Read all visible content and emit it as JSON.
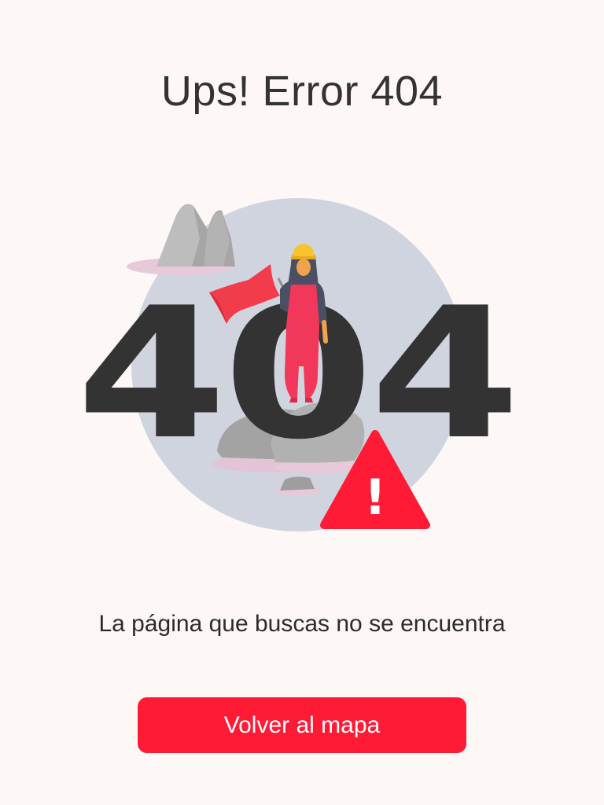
{
  "page": {
    "title": "Ups! Error 404",
    "message": "La página que buscas no se encuentra",
    "back_button_label": "Volver al mapa"
  },
  "illustration": {
    "big_text": "404",
    "warning_symbol": "!",
    "icons": [
      "rock-icon",
      "worker-with-flag-icon",
      "warning-triangle-icon"
    ]
  },
  "colors": {
    "background": "#fdf7f6",
    "accent": "#ff1a35",
    "digits": "#333333",
    "circle": "#d0d4de",
    "rock": "#a9a9a9"
  }
}
